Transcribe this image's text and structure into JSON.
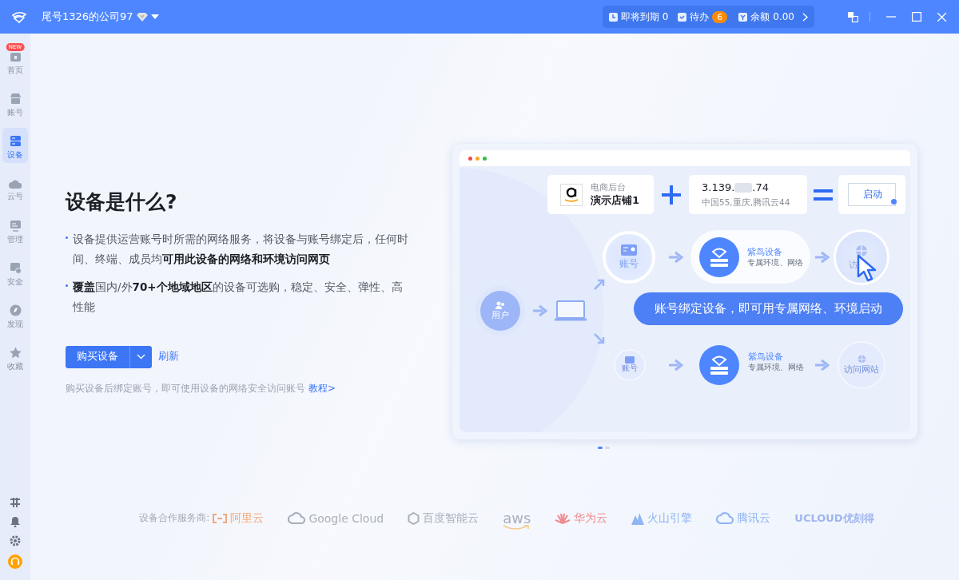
{
  "titlebar": {
    "company": "尾号1326的公司97",
    "expiring_label": "即将到期",
    "expiring_count": "0",
    "todo_label": "待办",
    "todo_count": "6",
    "balance_label": "余额",
    "balance_value": "0.00"
  },
  "sidebar": {
    "items": [
      {
        "label": "首页",
        "badge": "NEW",
        "kind": "home",
        "selected": false
      },
      {
        "label": "账号",
        "kind": "shop",
        "selected": false
      },
      {
        "label": "设备",
        "kind": "server",
        "selected": true
      },
      {
        "label": "云号",
        "kind": "cloud",
        "selected": false
      },
      {
        "label": "管理",
        "kind": "monitor",
        "selected": false
      },
      {
        "label": "安全",
        "kind": "shield",
        "selected": false
      },
      {
        "label": "发现",
        "kind": "compass",
        "selected": false
      },
      {
        "label": "收藏",
        "kind": "star",
        "selected": false
      }
    ]
  },
  "intro": {
    "title": "设备是什么?",
    "bullets": [
      "设备提供运营账号时所需的网络服务，将设备与账号绑定后，任何时间、终端、成员均**可用此设备的网络和环境访问网页**",
      "**覆盖**国内/外**70+个地域地区**的设备可选购，稳定、安全、弹性、高性能"
    ],
    "buy_button": "购买设备",
    "refresh_link": "刷新",
    "note": "购买设备后绑定账号，即可使用设备的网络安全访问账号",
    "tutorial_link": "教程>"
  },
  "illustration": {
    "store_label": "电商后台",
    "store_name": "演示店铺1",
    "ip_prefix": "3.139.",
    "ip_suffix": ".74",
    "ip_location": "中国55,重庆,腾讯云44",
    "launch_button": "启动",
    "account_label": "账号",
    "device_title": "紫鸟设备",
    "device_desc": "专属环境、网络",
    "visit_label": "访",
    "banner": "账号绑定设备，即可用专属网络、环境启动",
    "user_label": "用户",
    "account_label_2": "账号",
    "device_title_2": "紫鸟设备",
    "device_desc_2": "专属环境、网络",
    "visit_label_2": "访问网站"
  },
  "carousel": [
    {
      "selected": true
    },
    {
      "selected": false
    }
  ],
  "partners": {
    "label": "设备合作服务商:",
    "items": [
      {
        "name": "阿里云",
        "kind": "bracket",
        "color": "#f5a877"
      },
      {
        "name": "Google Cloud",
        "kind": "cloud",
        "color": "#a9afba"
      },
      {
        "name": "百度智能云",
        "kind": "hexagon",
        "color": "#a9afba"
      },
      {
        "name": "aws",
        "kind": "smile",
        "color": "#a9afba"
      },
      {
        "name": "华为云",
        "kind": "petals",
        "color": "#ee8d91"
      },
      {
        "name": "火山引擎",
        "kind": "peaks",
        "color": "#8fb5f2"
      },
      {
        "name": "腾讯云",
        "kind": "cloud",
        "color": "#8fb5f2"
      },
      {
        "name": "UCLOUD优刻得",
        "kind": "none",
        "color": "#9fb5f0"
      }
    ]
  }
}
